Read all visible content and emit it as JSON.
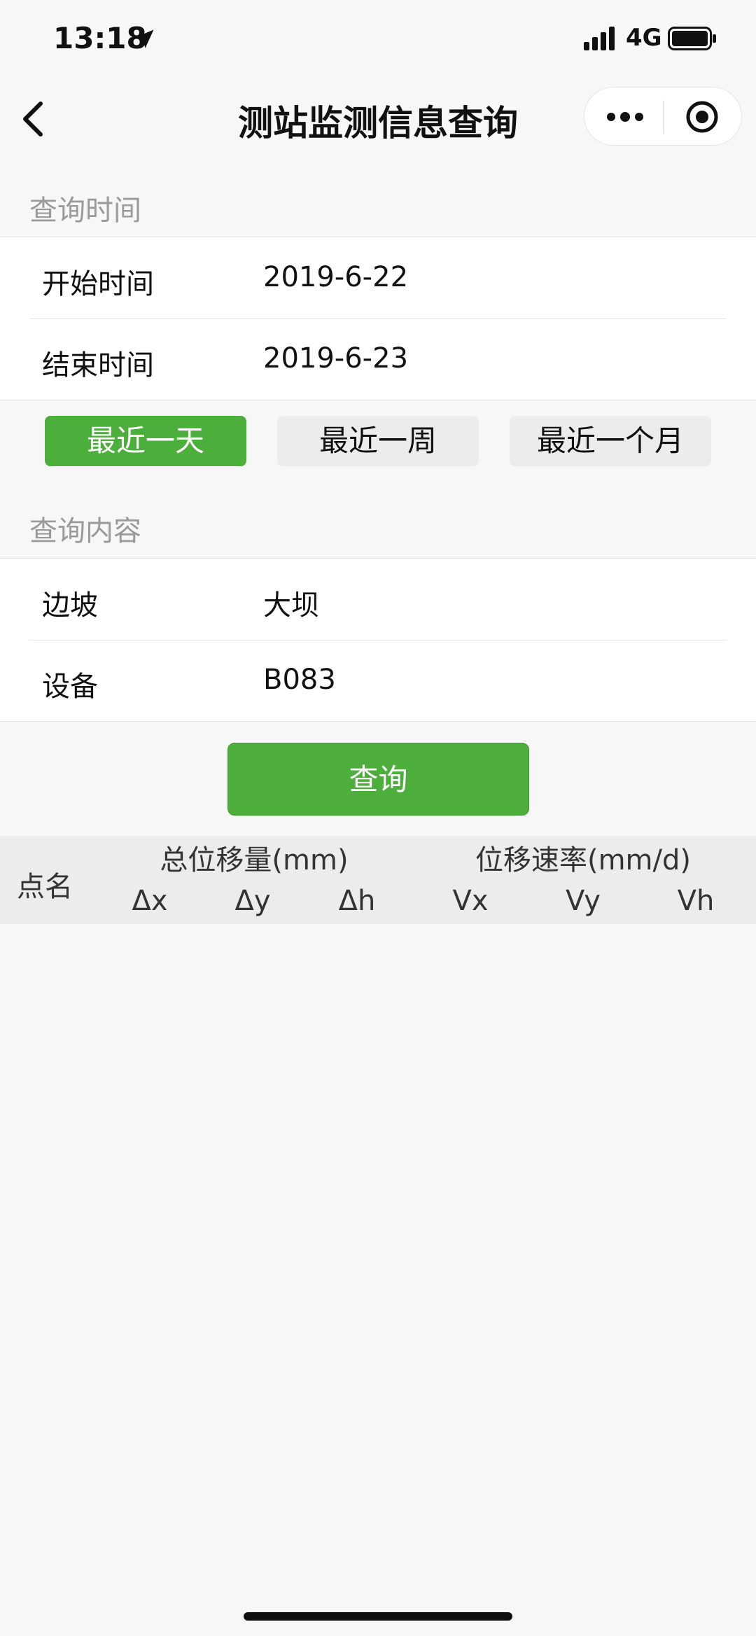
{
  "status_bar": {
    "time": "13:18",
    "network": "4G"
  },
  "nav": {
    "title": "测站监测信息查询"
  },
  "time_section": {
    "title": "查询时间",
    "start_label": "开始时间",
    "start_value": "2019-6-22",
    "end_label": "结束时间",
    "end_value": "2019-6-23"
  },
  "quick_range": {
    "buttons": [
      "最近一天",
      "最近一周",
      "最近一个月"
    ],
    "active_index": 0
  },
  "content_section": {
    "title": "查询内容",
    "slope_label": "边坡",
    "slope_value": "大坝",
    "device_label": "设备",
    "device_value": "B083"
  },
  "query_button": "查询",
  "table": {
    "point_name": "点名",
    "group1_title": "总位移量(mm)",
    "group2_title": "位移速率(mm/d)",
    "columns": [
      "Δx",
      "Δy",
      "Δh",
      "Vx",
      "Vy",
      "Vh"
    ]
  },
  "colors": {
    "accent": "#4caf3c",
    "background": "#f7f7f7"
  },
  "icons": {
    "back": "chevron-left-icon",
    "more": "more-dots-icon",
    "close": "target-icon",
    "location": "location-arrow-icon",
    "signal": "signal-icon",
    "battery": "battery-icon"
  }
}
